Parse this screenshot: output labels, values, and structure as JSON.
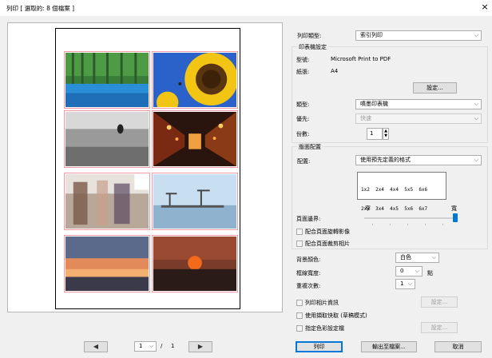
{
  "window": {
    "title": "列印 [ 選取的: 8 個檔案 ]",
    "close_glyph": "×"
  },
  "preview": {
    "photos": [
      {
        "name": "photo-forest-lake",
        "icon": "landscape"
      },
      {
        "name": "photo-sunflower",
        "icon": "flower"
      },
      {
        "name": "photo-figure-in-water",
        "icon": "landscape"
      },
      {
        "name": "photo-night-alley",
        "icon": "street"
      },
      {
        "name": "photo-blurred-crowd",
        "icon": "people"
      },
      {
        "name": "photo-harbor-cranes",
        "icon": "harbor"
      },
      {
        "name": "photo-sunset-sky",
        "icon": "sunset"
      },
      {
        "name": "photo-red-sun",
        "icon": "sunset"
      }
    ],
    "nav": {
      "prev": "◀",
      "next": "▶",
      "page": "1",
      "separator": "/",
      "total": "1"
    }
  },
  "settings": {
    "print_type_label": "列印類型:",
    "print_type_value": "索引列印",
    "printer_group": "印表機設定",
    "model_label": "型號:",
    "model_value": "Microsoft Print to PDF",
    "paper_label": "紙張:",
    "paper_value": "A4",
    "setup_button": "設定...",
    "type_label": "類型:",
    "type_value": "噴墨印表機",
    "priority_label": "優先:",
    "priority_value": "快速",
    "copies_label": "份數:",
    "copies_value": "1",
    "layout_group": "版面配置",
    "layout_label": "配置:",
    "layout_value": "使用預先定義的格式",
    "layout_options": [
      [
        "1x2",
        "2x4",
        "4x4",
        "5x5",
        "6x6"
      ],
      [
        "2x2",
        "3x4",
        "4x5",
        "5x6",
        "6x7"
      ]
    ],
    "margin_label": "頁面邊界:",
    "margin_narrow": "窄",
    "margin_wide": "寬",
    "margin_level": 1.0,
    "auto_rotate": "配合頁面旋轉影像",
    "crop_fit": "配合頁面裁剪相片",
    "bg_color_label": "背景顏色:",
    "bg_color_value": "白色",
    "border_width_label": "框線寬度:",
    "border_width_value": "0",
    "border_width_unit": "點",
    "repeat_label": "重複次數:",
    "repeat_value": "1",
    "print_info": "列印相片資訊",
    "quick_mode": "使用擷取快取 (草稿模式)",
    "color_profile": "指定色彩設定檔",
    "info_setup": "設定...",
    "profile_setup": "設定..."
  },
  "footer": {
    "print": "列印",
    "export": "輸出至檔案...",
    "cancel": "取消"
  },
  "colors": {
    "accent": "#0078d7",
    "cell_border": "#f29aa6"
  }
}
